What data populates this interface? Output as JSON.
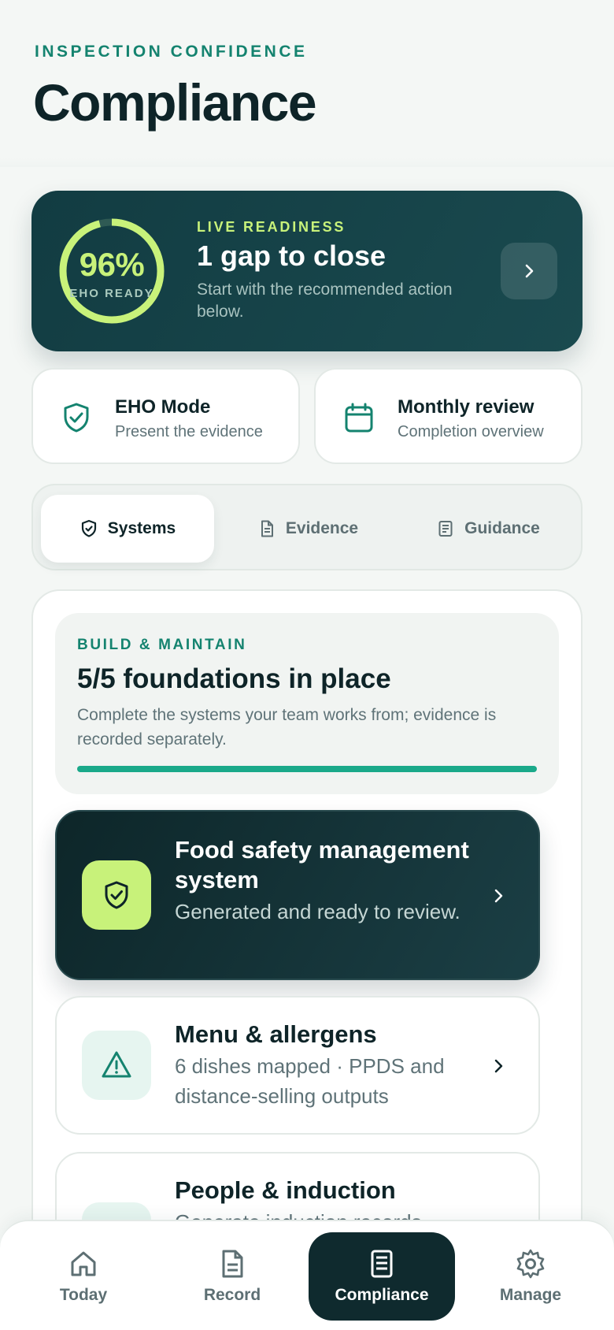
{
  "header": {
    "eyebrow": "INSPECTION CONFIDENCE",
    "title": "Compliance"
  },
  "readiness": {
    "percent_label": "96%",
    "percent_value": 96,
    "ring_label": "EHO READY",
    "eyebrow": "LIVE READINESS",
    "title": "1 gap to close",
    "description": "Start with the recommended action below.",
    "colors": {
      "ring": "#c8f27a",
      "card": "#123c42"
    }
  },
  "quick_actions": [
    {
      "icon": "shield-check-icon",
      "title": "EHO Mode",
      "subtitle": "Present the evidence"
    },
    {
      "icon": "calendar-icon",
      "title": "Monthly review",
      "subtitle": "Completion overview"
    }
  ],
  "tabs": [
    {
      "icon": "shield-check-icon",
      "label": "Systems",
      "active": true
    },
    {
      "icon": "document-icon",
      "label": "Evidence",
      "active": false
    },
    {
      "icon": "book-icon",
      "label": "Guidance",
      "active": false
    }
  ],
  "build": {
    "eyebrow": "BUILD & MAINTAIN",
    "title": "5/5 foundations in place",
    "description": "Complete the systems your team works from; evidence is recorded separately.",
    "progress": 1.0
  },
  "systems": [
    {
      "icon": "shield-check-icon",
      "title": "Food safety management system",
      "subtitle": "Generated and ready to review.",
      "style": "dark"
    },
    {
      "icon": "warning-icon",
      "title": "Menu & allergens",
      "subtitle": "6 dishes mapped · PPDS and distance-selling outputs",
      "style": "light"
    },
    {
      "icon": "people-icon",
      "title": "People & induction",
      "subtitle": "Generate induction records",
      "style": "light"
    }
  ],
  "bottom_nav": [
    {
      "icon": "home-icon",
      "label": "Today",
      "active": false
    },
    {
      "icon": "document-icon",
      "label": "Record",
      "active": false
    },
    {
      "icon": "book-icon",
      "label": "Compliance",
      "active": true
    },
    {
      "icon": "gear-icon",
      "label": "Manage",
      "active": false
    }
  ]
}
